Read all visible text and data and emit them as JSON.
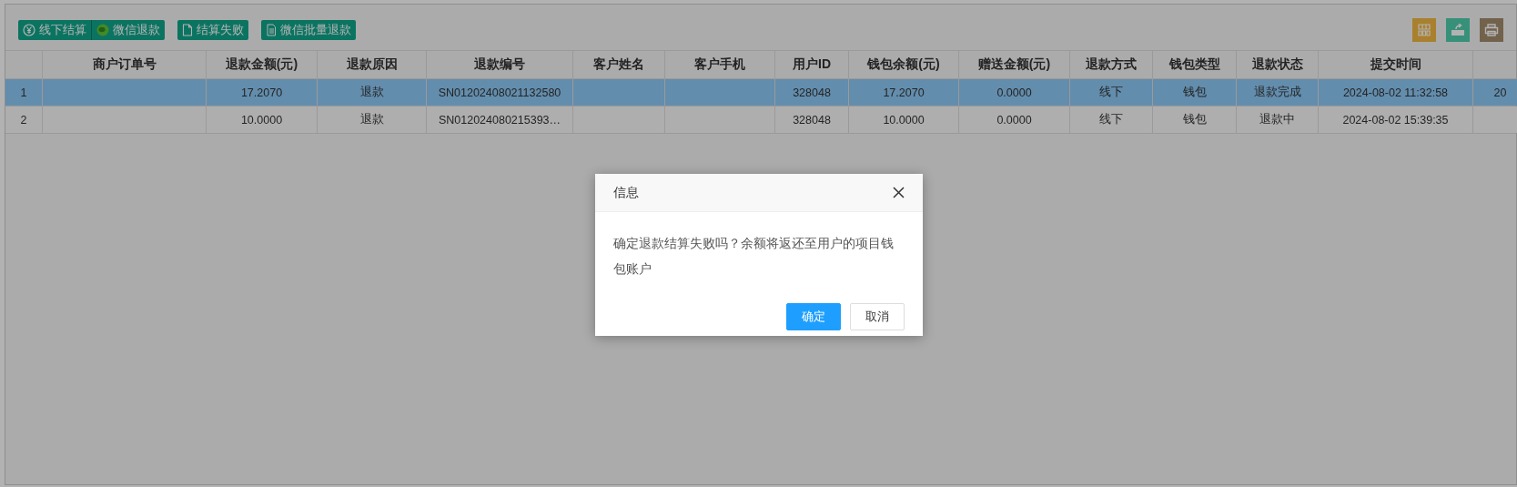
{
  "toolbar": {
    "button_groups": [
      [
        {
          "label": "线下结算",
          "kind": "yen"
        },
        {
          "label": "微信退款",
          "kind": "wechat"
        }
      ],
      [
        {
          "label": "结算失败",
          "kind": "doc"
        }
      ],
      [
        {
          "label": "微信批量退款",
          "kind": "list"
        }
      ]
    ],
    "tools": [
      {
        "kind": "columns"
      },
      {
        "kind": "export"
      },
      {
        "kind": "print"
      }
    ]
  },
  "table": {
    "columns": [
      "",
      "商户订单号",
      "退款金额(元)",
      "退款原因",
      "退款编号",
      "客户姓名",
      "客户手机",
      "用户ID",
      "钱包余额(元)",
      "赠送金额(元)",
      "退款方式",
      "钱包类型",
      "退款状态",
      "提交时间",
      ""
    ],
    "rows": [
      {
        "selected": true,
        "cells": [
          "1",
          "",
          "17.2070",
          "退款",
          "SN01202408021132580",
          "",
          "",
          "328048",
          "17.2070",
          "0.0000",
          "线下",
          "钱包",
          "退款完成",
          "2024-08-02 11:32:58",
          "20"
        ]
      },
      {
        "selected": false,
        "cells": [
          "2",
          "",
          "10.0000",
          "退款",
          "SN012024080215393…",
          "",
          "",
          "328048",
          "10.0000",
          "0.0000",
          "线下",
          "钱包",
          "退款中",
          "2024-08-02 15:39:35",
          ""
        ]
      }
    ]
  },
  "dialog": {
    "title": "信息",
    "message": "确定退款结算失败吗？余额将返还至用户的项目钱包账户",
    "buttons": [
      {
        "label": "确定",
        "kind": "primary"
      },
      {
        "label": "取消",
        "kind": "secondary"
      }
    ]
  }
}
